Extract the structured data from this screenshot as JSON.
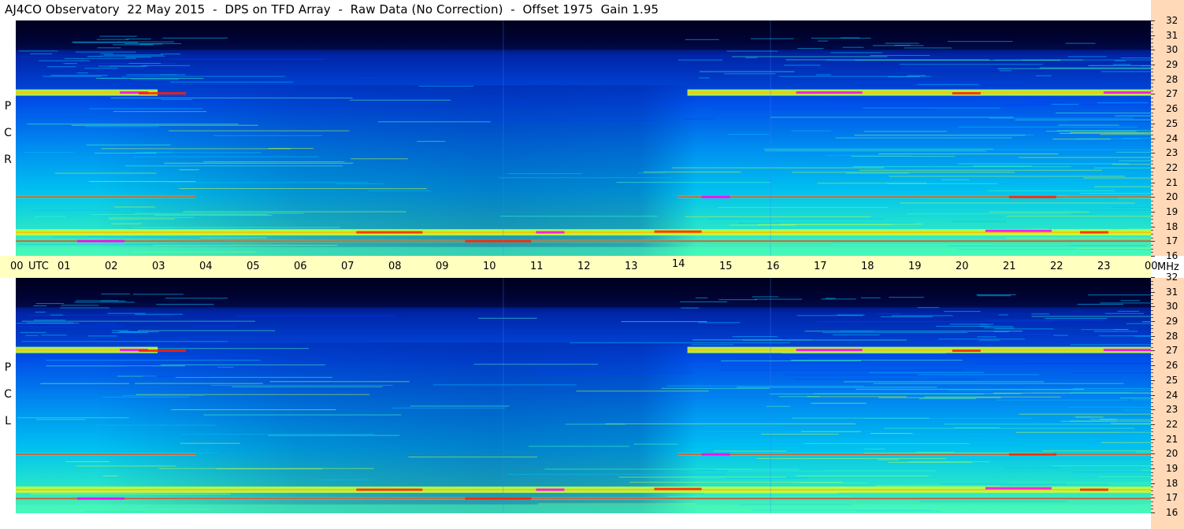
{
  "title": "AJ4CO Observatory  22 May 2015  -  DPS on TFD Array  -  Raw Data (No Correction)  -  Offset 1975  Gain 1.95",
  "panels": [
    {
      "id": "rcp",
      "label_letters": [
        "R",
        "C",
        "P"
      ]
    },
    {
      "id": "lcp",
      "label_letters": [
        "L",
        "C",
        "P"
      ]
    }
  ],
  "time_axis": {
    "labels": [
      "00",
      "UTC",
      "01",
      "02",
      "03",
      "04",
      "05",
      "06",
      "07",
      "08",
      "09",
      "10",
      "11",
      "12",
      "13",
      "14",
      "15",
      "16",
      "17",
      "18",
      "19",
      "20",
      "21",
      "22",
      "23",
      "00"
    ]
  },
  "freq_axis": {
    "unit": "MHz",
    "labels": [
      "16",
      "17",
      "18",
      "19",
      "20",
      "21",
      "22",
      "23",
      "24",
      "25",
      "26",
      "27",
      "28",
      "29",
      "30",
      "31",
      "32"
    ]
  },
  "colors": {
    "time_bar": "#ffffc0",
    "freq_bar": "#ffd9b8",
    "colormap": [
      "#000020",
      "#000080",
      "#0040ff",
      "#00c0ff",
      "#40ffc0",
      "#c0ff40",
      "#ffc000",
      "#ff2000",
      "#ff00ff"
    ]
  },
  "chart_data": {
    "type": "heatmap",
    "title": "AJ4CO Observatory  22 May 2015  -  DPS on TFD Array  -  Raw Data (No Correction)  -  Offset 1975  Gain 1.95",
    "x_range_utc_hours": [
      0,
      24
    ],
    "y_range_mhz": [
      16,
      32
    ],
    "panels": [
      "RCP",
      "LCP"
    ],
    "features": [
      {
        "name": "band",
        "mhz": 27.1,
        "active_utc": [
          [
            0,
            3.0
          ],
          [
            14.2,
            24
          ]
        ],
        "intensity": "high"
      },
      {
        "name": "band",
        "mhz": 17.6,
        "active_utc": [
          [
            0,
            24
          ]
        ],
        "intensity": "high"
      },
      {
        "name": "band",
        "mhz": 17.0,
        "active_utc": [
          [
            0,
            24
          ]
        ],
        "intensity": "medium"
      },
      {
        "name": "band",
        "mhz": 20.0,
        "active_utc": [
          [
            0,
            3.8
          ],
          [
            14.0,
            24
          ]
        ],
        "intensity": "medium"
      },
      {
        "name": "upper_cutoff",
        "mhz": 30.0,
        "note": "dark region above ~30 MHz"
      }
    ],
    "grid": false
  }
}
